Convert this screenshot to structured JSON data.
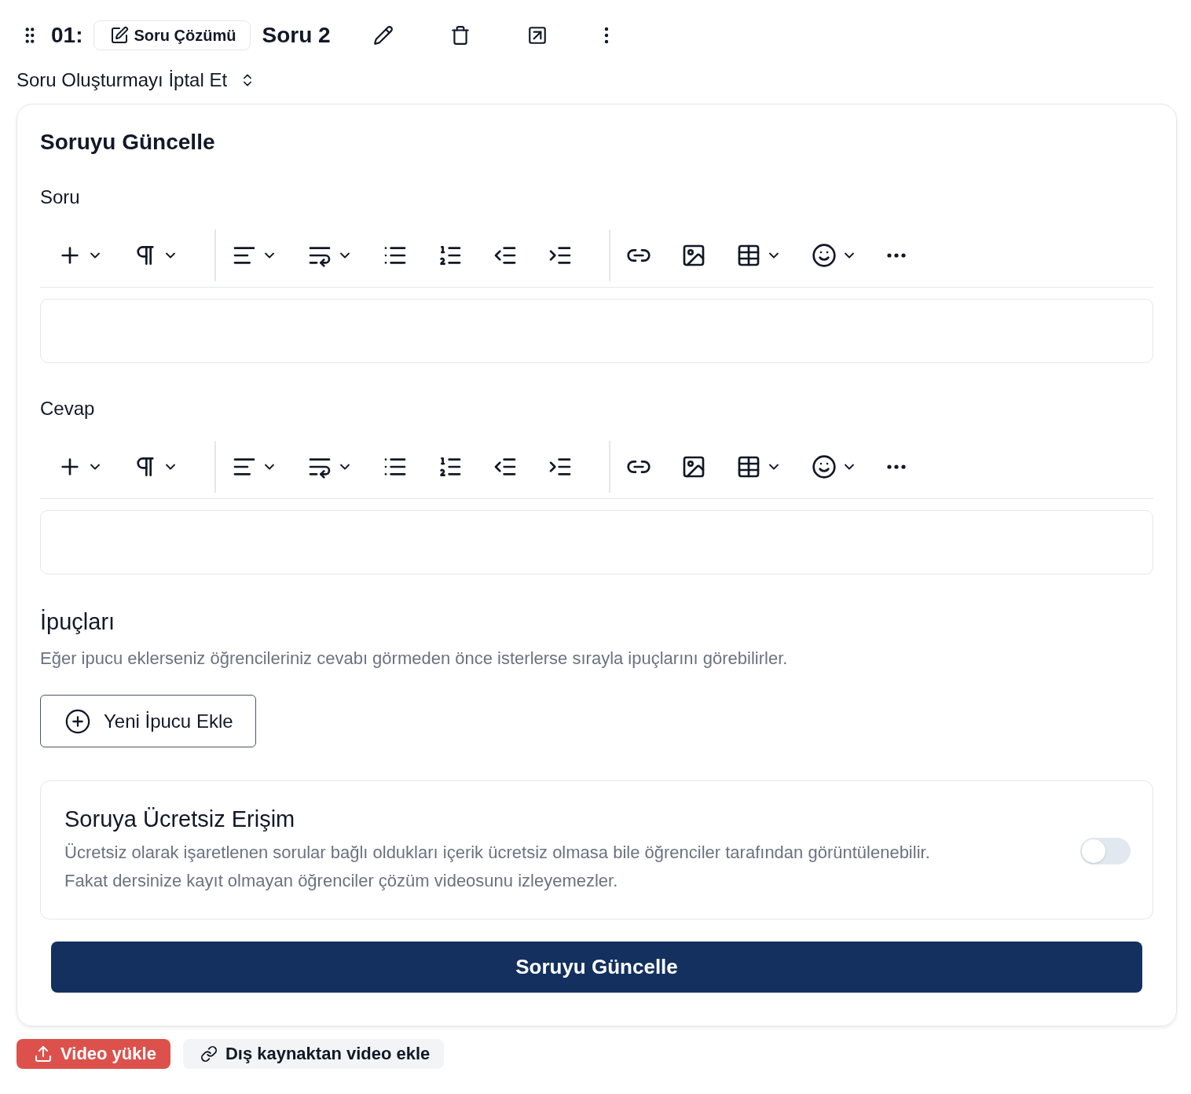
{
  "header": {
    "number": "01:",
    "solution_button": "Soru Çözümü",
    "title": "Soru 2"
  },
  "cancel_toggle": "Soru Oluşturmayı İptal Et",
  "form": {
    "title": "Soruyu Güncelle",
    "editors": [
      {
        "label": "Soru"
      },
      {
        "label": "Cevap"
      }
    ],
    "hints": {
      "title": "İpuçları",
      "description": "Eğer ipucu eklerseniz öğrencileriniz cevabı görmeden önce isterlerse sırayla ipuçlarını görebilirler.",
      "add_button": "Yeni İpucu Ekle"
    },
    "free_access": {
      "title": "Soruya Ücretsiz Erişim",
      "description": "Ücretsiz olarak işaretlenen sorular bağlı oldukları içerik ücretsiz olmasa bile öğrenciler tarafından görüntülenebilir.\nFakat dersinize kayıt olmayan öğrenciler çözüm videosunu izleyemezler.",
      "on": false
    },
    "submit_button": "Soruyu Güncelle"
  },
  "video_buttons": [
    {
      "kind": "upload",
      "label": "Video yükle"
    },
    {
      "kind": "link",
      "label": "Dış kaynaktan video ekle"
    }
  ]
}
